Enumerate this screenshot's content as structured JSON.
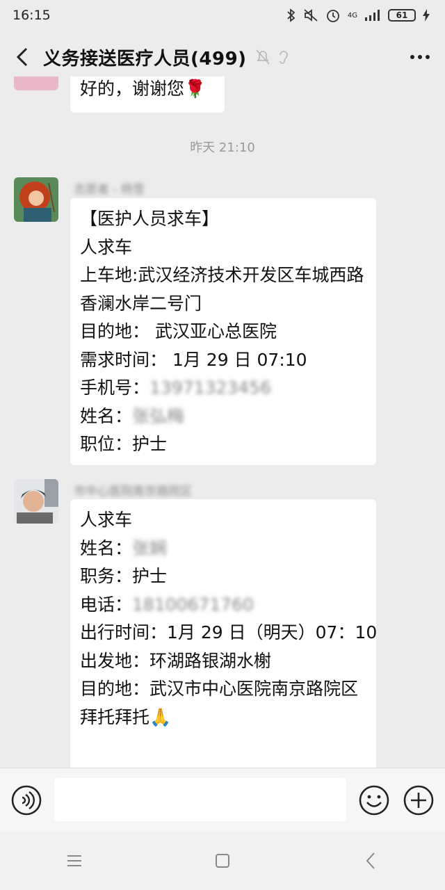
{
  "status_bar": {
    "time": "16:15",
    "network": "4G",
    "battery": "61",
    "icons": [
      "bluetooth-icon",
      "mute-icon",
      "alarm-icon",
      "signal-icon",
      "battery-icon",
      "charging-icon"
    ]
  },
  "header": {
    "title": "义务接送医疗人员(499)",
    "icons": [
      "back-arrow-icon",
      "muted-bell-icon",
      "ear-icon",
      "more-icon"
    ]
  },
  "chat": {
    "prev_message": {
      "text": "好的，谢谢您",
      "emoji": "🌹"
    },
    "timestamp": "昨天 21:10",
    "messages": [
      {
        "sender": "志愿者 - 杨雪",
        "lines": [
          "【医护人员求车】",
          "人求车",
          "上车地:武汉经济技术开发区车城西路 香澜水岸二号门",
          "目的地： 武汉亚心总医院",
          "需求时间： 1月 29 日 07:10"
        ],
        "phone_label": "手机号：",
        "phone_value": "13971323456",
        "name_label": "姓名：",
        "name_value": "张弘梅",
        "role_line": "职位：护士"
      },
      {
        "sender": "市中心医院南京路院区",
        "line_first": "人求车",
        "name_label": "姓名：",
        "name_value": "张娴",
        "role_line": "职务：护士",
        "phone_label": "电话：",
        "phone_value": "18100671760",
        "lines": [
          "出行时间：1月 29 日（明天）07：10",
          "出发地：环湖路银湖水榭",
          "目的地：武汉市中心医院南京路院区"
        ],
        "closing": "拜托拜托",
        "closing_emoji": "🙏"
      }
    ]
  },
  "input_bar": {
    "icons": [
      "voice-icon",
      "emoji-icon",
      "add-icon"
    ],
    "value": ""
  },
  "nav_bar": {
    "icons": [
      "menu-icon",
      "home-icon",
      "back-icon"
    ]
  }
}
